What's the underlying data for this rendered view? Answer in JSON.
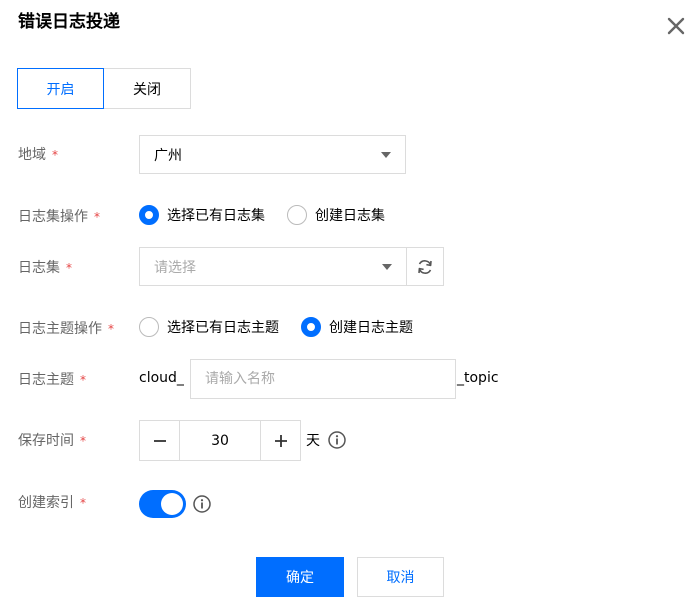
{
  "dialog": {
    "title": "错误日志投递"
  },
  "toggle_group": {
    "on_label": "开启",
    "off_label": "关闭",
    "selected": "开启"
  },
  "form": {
    "region": {
      "label": "地域",
      "value": "广州"
    },
    "logset_op": {
      "label": "日志集操作",
      "option_existing": "选择已有日志集",
      "option_create": "创建日志集",
      "selected": "选择已有日志集"
    },
    "logset": {
      "label": "日志集",
      "placeholder": "请选择"
    },
    "topic_op": {
      "label": "日志主题操作",
      "option_existing": "选择已有日志主题",
      "option_create": "创建日志主题",
      "selected": "创建日志主题"
    },
    "topic": {
      "label": "日志主题",
      "prefix": "cloud_",
      "placeholder": "请输入名称",
      "suffix": "_topic"
    },
    "retention": {
      "label": "保存时间",
      "value": "30",
      "unit": "天"
    },
    "index": {
      "label": "创建索引",
      "enabled": true
    }
  },
  "required_mark": "*",
  "footer": {
    "confirm_label": "确定",
    "cancel_label": "取消"
  },
  "colors": {
    "accent": "#006eff",
    "required": "#e54545",
    "border": "#dcdcdc",
    "label": "#666666"
  },
  "icons": [
    "close-icon",
    "caret-down-icon",
    "refresh-icon",
    "minus-icon",
    "plus-icon",
    "info-icon"
  ]
}
